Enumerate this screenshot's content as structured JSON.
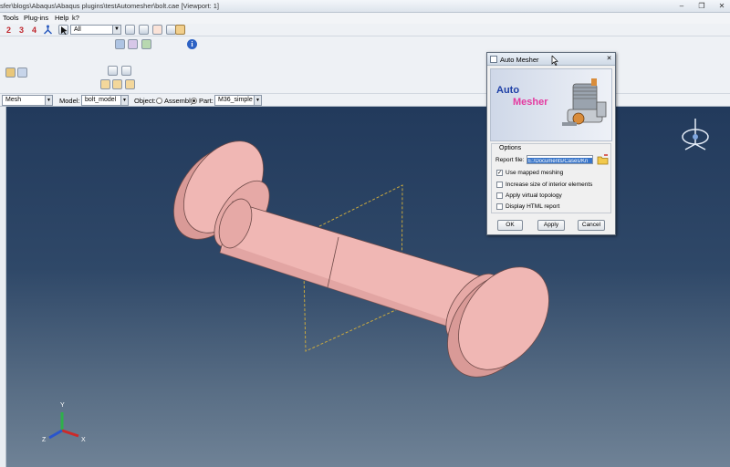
{
  "window": {
    "title": "sfer\\blogs\\Abaqus\\Abaqus plugins\\testAutomesher\\bolt.cae [Viewport: 1]",
    "minimize": "–",
    "restore": "❐",
    "close": "✕"
  },
  "menu": {
    "items": [
      "Tools",
      "Plug-ins",
      "Help",
      "k?"
    ]
  },
  "toolbar": {
    "numbers": [
      "2",
      "3",
      "4"
    ],
    "selection_filter": "All"
  },
  "context": {
    "module_value": "Mesh",
    "model_label": "Model:",
    "model_value": "bolt_model",
    "object_label": "Object:",
    "assembly_label": "Assembly",
    "part_label": "Part:",
    "part_value": "M36_simple",
    "object_selected": "Part"
  },
  "dialog": {
    "title": "Auto Mesher",
    "banner_line1": "Auto",
    "banner_line2": "Mesher",
    "options_legend": "Options",
    "report_file_label": "Report file:",
    "report_file_value": "E:/Documents/Cases/Kn",
    "options": [
      {
        "label": "Use mapped meshing",
        "checked": true
      },
      {
        "label": "Increase size of interior elements",
        "checked": false
      },
      {
        "label": "Apply virtual topology",
        "checked": false
      },
      {
        "label": "Display HTML report",
        "checked": false
      }
    ],
    "buttons": {
      "ok": "OK",
      "apply": "Apply",
      "cancel": "Cancel"
    }
  },
  "triad": {
    "y": "Y",
    "z": "Z",
    "x": "X"
  },
  "colors": {
    "bolt_face": "#f0b7b4",
    "bolt_shade": "#d99a97",
    "viewport_top": "#223a5c",
    "viewport_bottom": "#6f8296",
    "banner_auto": "#1d3fa6",
    "banner_mesher": "#e43aa0"
  }
}
